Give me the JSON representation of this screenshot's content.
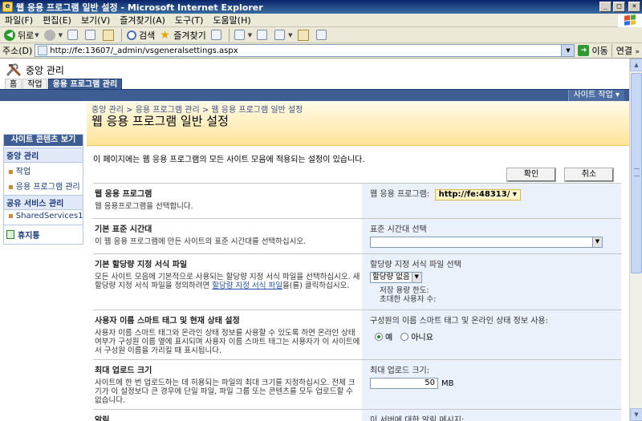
{
  "window": {
    "title": "웹 응용 프로그램 일반 설정 - Microsoft Internet Explorer"
  },
  "menu": [
    "파일(F)",
    "편집(E)",
    "보기(V)",
    "즐겨찾기(A)",
    "도구(T)",
    "도움말(H)"
  ],
  "toolbar": {
    "back": "뒤로",
    "search": "검색",
    "favorites": "즐겨찾기"
  },
  "address": {
    "label": "주소(D)",
    "url": "http://fe:13607/_admin/vsgeneralsettings.aspx",
    "go": "이동",
    "links": "연결"
  },
  "sp": {
    "site_title": "중앙 관리",
    "tabs": [
      "홈",
      "작업",
      "응용 프로그램 관리"
    ],
    "site_actions": "사이트 작업 ▾",
    "breadcrumb": "중앙 관리 > 응용 프로그램 관리 > 웹 응용 프로그램 일반 설정",
    "page_title": "웹 응용 프로그램 일반 설정"
  },
  "leftnav": {
    "view_all": "사이트 콘텐츠 보기",
    "groups": [
      {
        "heading": "중앙 관리",
        "items": [
          "작업",
          "응용 프로그램 관리"
        ]
      },
      {
        "heading": "공유 서비스 관리",
        "items": [
          "SharedServices1"
        ]
      }
    ],
    "recycle": "휴지통"
  },
  "main": {
    "description": "이 페이지에는 웹 응용 프로그램의 모든 사이트 모음에 적용되는 설정이 있습니다.",
    "ok": "확인",
    "cancel": "취소",
    "webapp": {
      "title": "웹 응용 프로그램",
      "desc": "웹 응용프로그램을 선택합니다.",
      "label": "웹 응용 프로그램:",
      "value": "http://fe:48313/ ▾"
    },
    "timezone": {
      "title": "기본 표준 시간대",
      "desc": "이 웹 응용 프로그램에 만든 사이트의 표준 시간대를 선택하십시오.",
      "label": "표준 시간대 선택",
      "value": ""
    },
    "quota": {
      "title": "기본 할당량 지정 서식 파일",
      "desc_1": "모든 사이트 모음에 기본적으로 사용되는 할당량 지정 서식 파일을 선택하십시오. 새 할당량 지정 서식 파일을 정의하려면",
      "desc_link": "할당량 지정 서식 파일",
      "desc_2": "을(를) 클릭하십시오.",
      "label": "할당량 지정 서식 파일 선택",
      "select": "할당량 없음",
      "storage": "저장 용량 한도:",
      "users": "초대한 사용자 수:"
    },
    "presence": {
      "title": "사용자 이름 스마트 태그 및 현재 상태 설정",
      "desc": "사용자 이름 스마트 태그와 온라인 상태 정보를 사용할 수 있도록 하면 온라인 상태 여부가 구성원 이름 옆에 표시되며 사용자 이름 스마트 태그는 사용자가 이 사이트에서 구성원 이름을 가리킬 때 표시됩니다.",
      "label": "구성원의 이름 스마트 태그 및 온라인 상태 정보 사용:",
      "yes": "예",
      "no": "아니요"
    },
    "upload": {
      "title": "최대 업로드 크기",
      "desc": "사이트에 한 번 업로드하는 데 허용되는 파일의 최대 크기를 지정하십시오. 전체 크기가 이 설정보다 큰 경우에 단일 파일, 파일 그룹 또는 콘텐츠를 모두 업로드할 수 없습니다.",
      "label": "최대 업로드 크기:",
      "value": "50",
      "unit": "MB"
    },
    "alerts": {
      "title": "알림",
      "label": "이 서버에 대한 알림 메시지:"
    }
  },
  "colors": {
    "nav_blue": "#3e5d92",
    "band_yellow": "#ffe39a",
    "panel_blue": "#eaf1fb"
  }
}
